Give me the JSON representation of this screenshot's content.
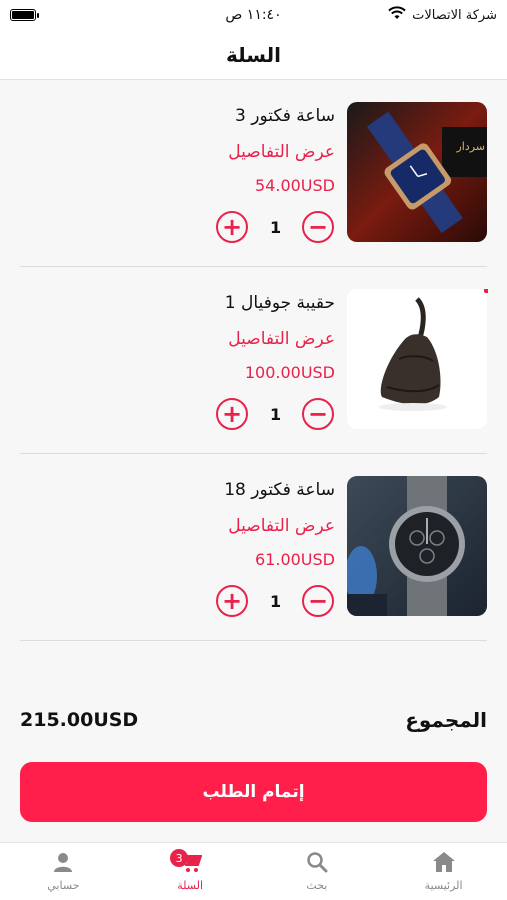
{
  "status": {
    "carrier": "شركة الاتصالات",
    "time": "١١:٤٠ ص"
  },
  "header": {
    "title": "السلة"
  },
  "items": [
    {
      "name": "ساعة فكتور 3",
      "details_label": "عرض التفاصيل",
      "price": "54.00USD",
      "qty": "1",
      "image_overlay": "سردار"
    },
    {
      "name": "حقيبة جوفيال 1",
      "details_label": "عرض التفاصيل",
      "price": "100.00USD",
      "qty": "1"
    },
    {
      "name": "ساعة فكتور 18",
      "details_label": "عرض التفاصيل",
      "price": "61.00USD",
      "qty": "1"
    }
  ],
  "summary": {
    "total_label": "المجموع",
    "total_value": "215.00USD"
  },
  "checkout": {
    "label": "إتمام الطلب"
  },
  "tabs": [
    {
      "label": "حسابي",
      "icon": "person-icon"
    },
    {
      "label": "السلة",
      "icon": "cart-icon",
      "badge": "3",
      "active": true
    },
    {
      "label": "بحث",
      "icon": "search-icon"
    },
    {
      "label": "الرئيسية",
      "icon": "home-icon"
    }
  ],
  "colors": {
    "accent": "#e8224b",
    "button": "#ff1f4a"
  }
}
